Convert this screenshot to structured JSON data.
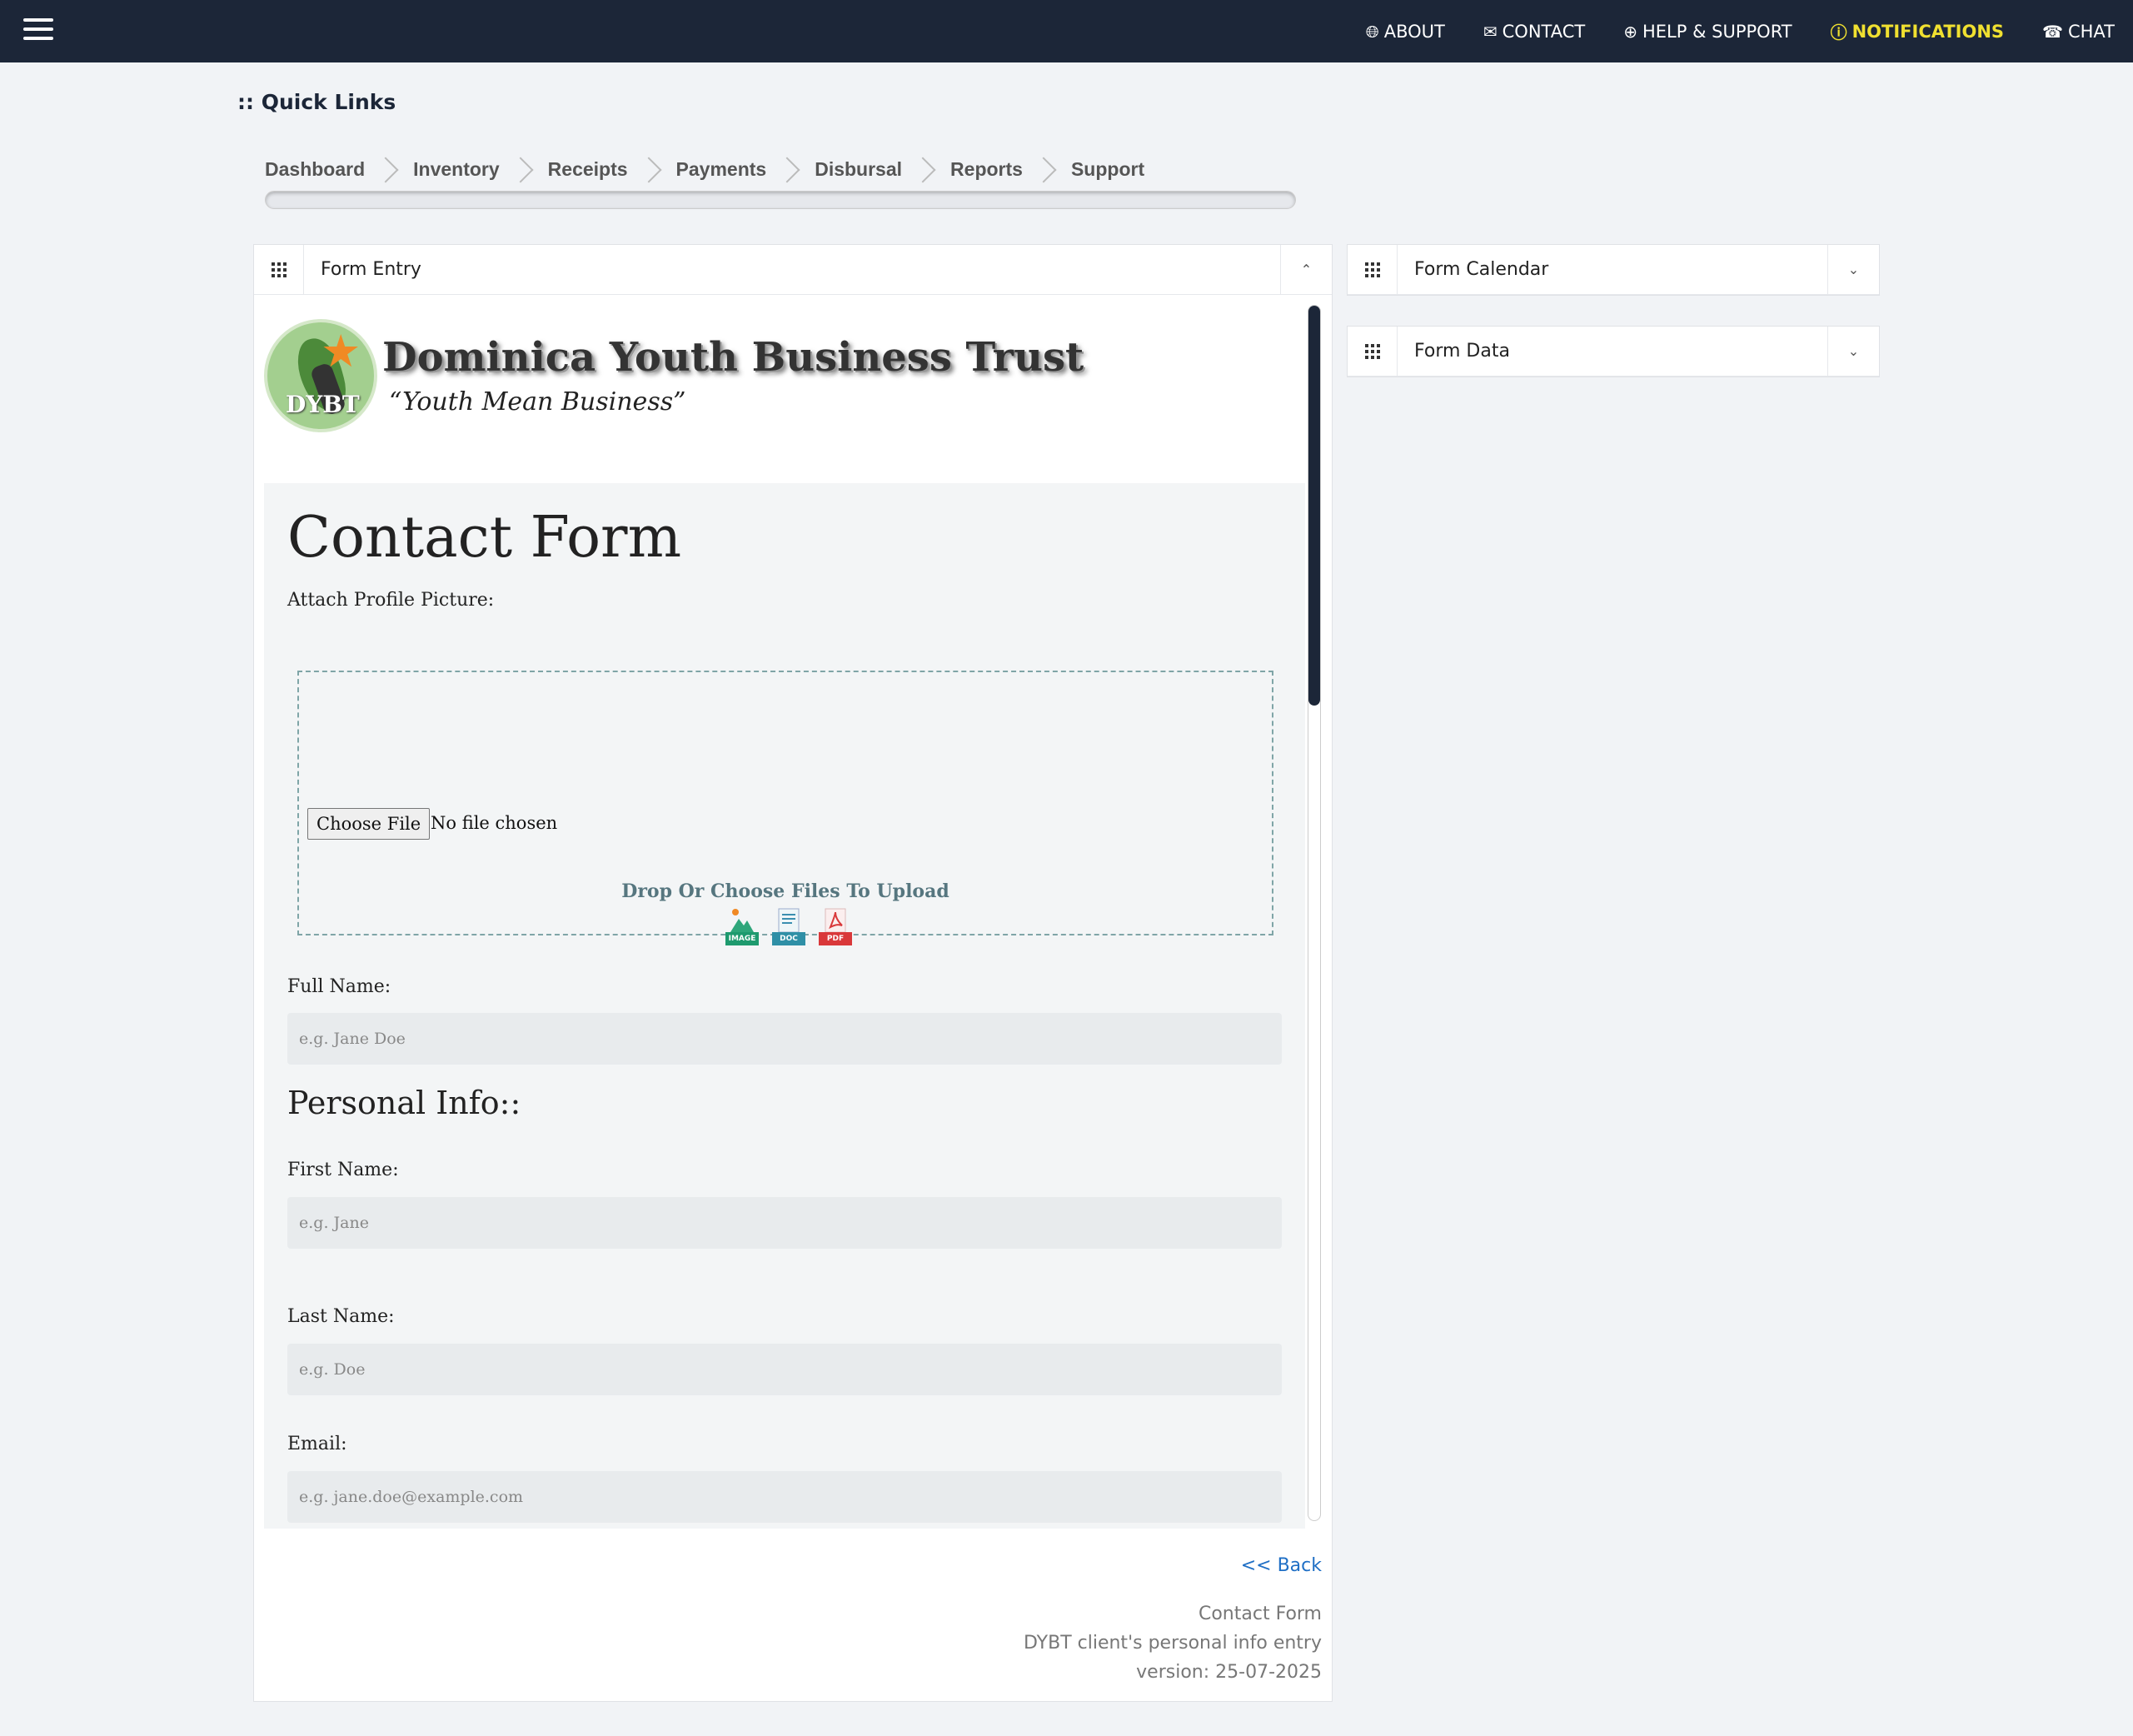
{
  "topbar": {
    "nav": [
      {
        "label": "ABOUT",
        "icon": "globe-icon"
      },
      {
        "label": "CONTACT",
        "icon": "contact-card-icon"
      },
      {
        "label": "HELP & SUPPORT",
        "icon": "lifebuoy-icon"
      },
      {
        "label": "NOTIFICATIONS",
        "icon": "alert-circle-icon",
        "color": "#f0e030"
      },
      {
        "label": "CHAT",
        "icon": "whatsapp-icon"
      }
    ]
  },
  "quick_links": {
    "title": ":: Quick Links",
    "items": [
      "Dashboard",
      "Inventory",
      "Receipts",
      "Payments",
      "Disbursal",
      "Reports",
      "Support"
    ]
  },
  "panels": {
    "form_entry": "Form Entry",
    "form_calendar": "Form Calendar",
    "form_data": "Form Data"
  },
  "logo": {
    "abbr": "DYBT",
    "name": "Dominica Youth Business Trust",
    "tagline": "“Youth Mean Business”"
  },
  "form": {
    "title": "Contact Form",
    "attach_label": "Attach Profile Picture:",
    "file_button": "Choose File",
    "file_status": "No file chosen",
    "drop_hint": "Drop Or Choose Files To Upload",
    "file_types": [
      "IMAGE",
      "DOC",
      "PDF"
    ],
    "full_name_label": "Full Name:",
    "full_name_placeholder": "e.g. Jane Doe",
    "section_personal": "Personal Info::",
    "first_name_label": "First Name:",
    "first_name_placeholder": "e.g. Jane",
    "last_name_label": "Last Name:",
    "last_name_placeholder": "e.g. Doe",
    "email_label": "Email:",
    "email_placeholder": "e.g. jane.doe@example.com"
  },
  "footer": {
    "back": "<< Back",
    "line1": "Contact Form",
    "line2": "DYBT client's personal info entry",
    "line3": "version: 25-07-2025"
  },
  "colors": {
    "topbar": "#1c2638",
    "accent_link": "#1f6fc5",
    "notification": "#f0e030"
  }
}
